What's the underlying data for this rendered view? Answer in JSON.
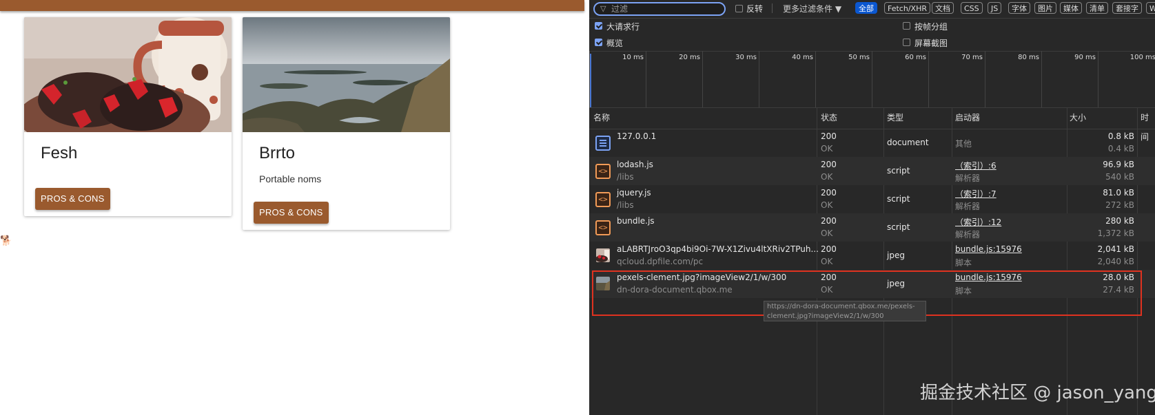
{
  "app": {
    "cards": [
      {
        "title": "Fesh",
        "description": "",
        "button": "PROS & CONS"
      },
      {
        "title": "Brrto",
        "description": "Portable noms",
        "button": "PROS & CONS"
      }
    ],
    "side_emoji": "🐕"
  },
  "devtools": {
    "filter_placeholder": "过滤",
    "invert_label": "反转",
    "more_filters_label": "更多过滤条件 ▼",
    "type_filters": [
      "全部",
      "Fetch/XHR",
      "文档",
      "CSS",
      "JS",
      "字体",
      "图片",
      "媒体",
      "清单",
      "套接字",
      "W"
    ],
    "options": {
      "big_rows": "大请求行",
      "overview": "概览",
      "group_by_frame": "按帧分组",
      "screenshots": "屏幕截图"
    },
    "timeline_ticks": [
      "10 ms",
      "20 ms",
      "30 ms",
      "40 ms",
      "50 ms",
      "60 ms",
      "70 ms",
      "80 ms",
      "90 ms",
      "100 ms"
    ],
    "columns": {
      "name": "名称",
      "status": "状态",
      "type": "类型",
      "initiator": "启动器",
      "size": "大小",
      "time": "时间"
    },
    "requests": [
      {
        "name": "127.0.0.1",
        "path": "",
        "status": "200",
        "status_text": "OK",
        "type": "document",
        "initiator": "其他",
        "initiator_sub": "",
        "size": "0.8 kB",
        "resource": "0.4 kB",
        "icon": "document-icon"
      },
      {
        "name": "lodash.js",
        "path": "/libs",
        "status": "200",
        "status_text": "OK",
        "type": "script",
        "initiator": "（索引）:6",
        "initiator_sub": "解析器",
        "size": "96.9 kB",
        "resource": "540 kB",
        "icon": "script-icon"
      },
      {
        "name": "jquery.js",
        "path": "/libs",
        "status": "200",
        "status_text": "OK",
        "type": "script",
        "initiator": "（索引）:7",
        "initiator_sub": "解析器",
        "size": "81.0 kB",
        "resource": "272 kB",
        "icon": "script-icon"
      },
      {
        "name": "bundle.js",
        "path": "",
        "status": "200",
        "status_text": "OK",
        "type": "script",
        "initiator": "（索引）:12",
        "initiator_sub": "解析器",
        "size": "280 kB",
        "resource": "1,372 kB",
        "icon": "script-icon"
      },
      {
        "name": "aLABRTJroO3qp4bi9Oi-7W-X1Zivu4ltXRiv2TPuh...",
        "path": "qcloud.dpfile.com/pc",
        "status": "200",
        "status_text": "OK",
        "type": "jpeg",
        "initiator": "bundle.js:15976",
        "initiator_sub": "脚本",
        "size": "2,041 kB",
        "resource": "2,040 kB",
        "icon": "image-thumbnail-icon"
      },
      {
        "name": "pexels-clement.jpg?imageView2/1/w/300",
        "path": "dn-dora-document.qbox.me",
        "status": "200",
        "status_text": "OK",
        "type": "jpeg",
        "initiator": "bundle.js:15976",
        "initiator_sub": "脚本",
        "size": "28.0 kB",
        "resource": "27.4 kB",
        "icon": "image-thumbnail-icon"
      }
    ],
    "tooltip": "https://dn-dora-document.qbox.me/pexels-clement.jpg?imageView2/1/w/300",
    "watermark": "掘金技术社区 @ jason_yang"
  }
}
